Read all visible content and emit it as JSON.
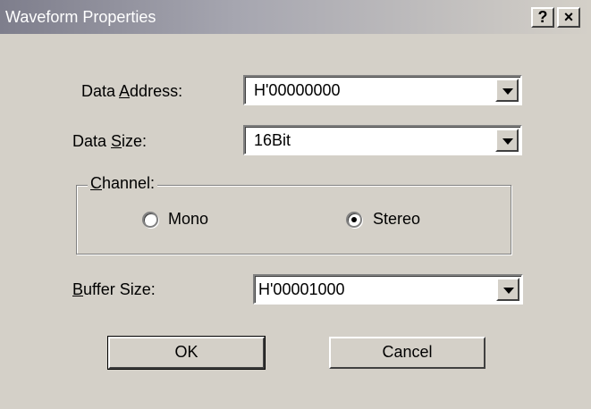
{
  "window": {
    "title": "Waveform Properties",
    "help_label": "?",
    "close_label": "×"
  },
  "form": {
    "data_address": {
      "label_pre": "Data ",
      "label_key": "A",
      "label_post": "ddress:",
      "value": "H'00000000"
    },
    "data_size": {
      "label_pre": "Data ",
      "label_key": "S",
      "label_post": "ize:",
      "value": "16Bit"
    },
    "channel": {
      "label_pre": "",
      "label_key": "C",
      "label_post": "hannel:",
      "options": [
        {
          "label": "Mono",
          "selected": false
        },
        {
          "label": "Stereo",
          "selected": true
        }
      ]
    },
    "buffer_size": {
      "label_pre": "",
      "label_key": "B",
      "label_post": "uffer Size:",
      "value": "H'00001000"
    }
  },
  "buttons": {
    "ok": "OK",
    "cancel": "Cancel"
  }
}
